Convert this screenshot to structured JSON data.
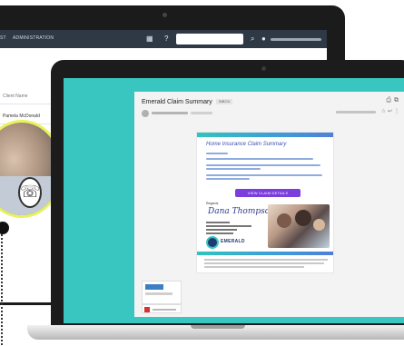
{
  "crm": {
    "nav_items": [
      "ST",
      "ADMINISTRATION"
    ],
    "grid_icon": "grid-icon",
    "help_icon": "help-icon",
    "user_icon": "user-icon",
    "row1_placeholder": "Client Name",
    "row2_value": "Pamela McDonald"
  },
  "email": {
    "subject": "Emerald Claim Summary",
    "subject_tag": "INBOX",
    "header_icons": [
      "print-icon",
      "open-in-new-icon"
    ],
    "card": {
      "title": "Home Insurance Claim Summary",
      "cta_label": "VIEW CLAIM DETAILS",
      "signature_label": "Regards,",
      "signature": "Dana Thompson",
      "brand": "EMERALD"
    }
  },
  "colors": {
    "laptop_screen": "#39c6c0",
    "cta": "#7b3ddb",
    "avatar_ring": "#e9f25a",
    "brand_navy": "#1e3a73"
  }
}
